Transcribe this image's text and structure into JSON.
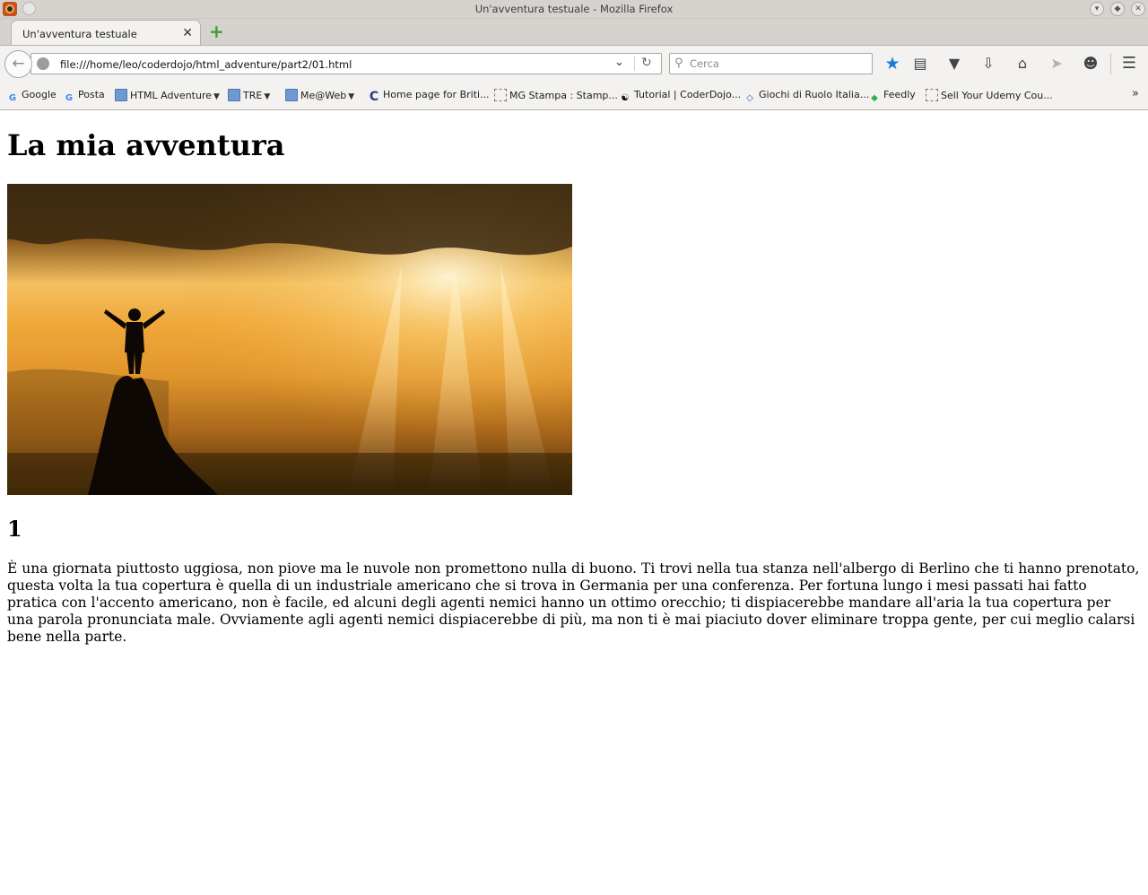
{
  "window": {
    "title": "Un'avventura testuale - Mozilla Firefox",
    "icon": "firefox-icon"
  },
  "tabs": [
    {
      "label": "Un'avventura testuale",
      "active": true
    }
  ],
  "navbar": {
    "url": "file:///home/leo/coderdojo/html_adventure/part2/01.html",
    "search_placeholder": "Cerca",
    "icons": [
      "back-icon",
      "globe-icon",
      "dropdown-icon",
      "reload-icon",
      "search-icon",
      "bookmark-star-icon",
      "reading-list-icon",
      "pocket-icon",
      "download-icon",
      "home-icon",
      "send-icon",
      "chat-icon",
      "menu-icon"
    ]
  },
  "bookmarks": [
    {
      "label": "Google",
      "icon": "google-icon"
    },
    {
      "label": "Posta",
      "icon": "google-icon"
    },
    {
      "label": "HTML Adventure",
      "icon": "folder-icon",
      "folder": true
    },
    {
      "label": "TRE",
      "icon": "folder-icon",
      "folder": true
    },
    {
      "label": "Me@Web",
      "icon": "folder-icon",
      "folder": true
    },
    {
      "label": "Home page for Briti...",
      "icon": "c-logo-icon"
    },
    {
      "label": "MG Stampa : Stamp...",
      "icon": "page-icon"
    },
    {
      "label": "Tutorial | CoderDojo...",
      "icon": "yinyang-icon"
    },
    {
      "label": "Giochi di Ruolo Italia...",
      "icon": "diamond-icon"
    },
    {
      "label": "Feedly",
      "icon": "feedly-icon"
    },
    {
      "label": "Sell Your Udemy Cou...",
      "icon": "page-icon"
    }
  ],
  "page": {
    "heading": "La mia avventura",
    "chapter": "1",
    "paragraph": "È una giornata piuttosto uggiosa, non piove ma le nuvole non promettono nulla di buono. Ti trovi nella tua stanza nell'albergo di Berlino che ti hanno prenotato, questa volta la tua copertura è quella di un industriale americano che si trova in Germania per una conferenza. Per fortuna lungo i mesi passati hai fatto pratica con l'accento americano, non è facile, ed alcuni degli agenti nemici hanno un ottimo orecchio; ti dispiacerebbe mandare all'aria la tua copertura per una parola pronunciata male. Ovviamente agli agenti nemici dispiacerebbe di più, ma non ti è mai piaciuto dover eliminare troppa gente, per cui meglio calarsi bene nella parte."
  },
  "colors": {
    "chrome": "#d6d3cf",
    "toolbar": "#f3f2f0",
    "star": "#1a7ad4",
    "newtab": "#3aa22f"
  }
}
